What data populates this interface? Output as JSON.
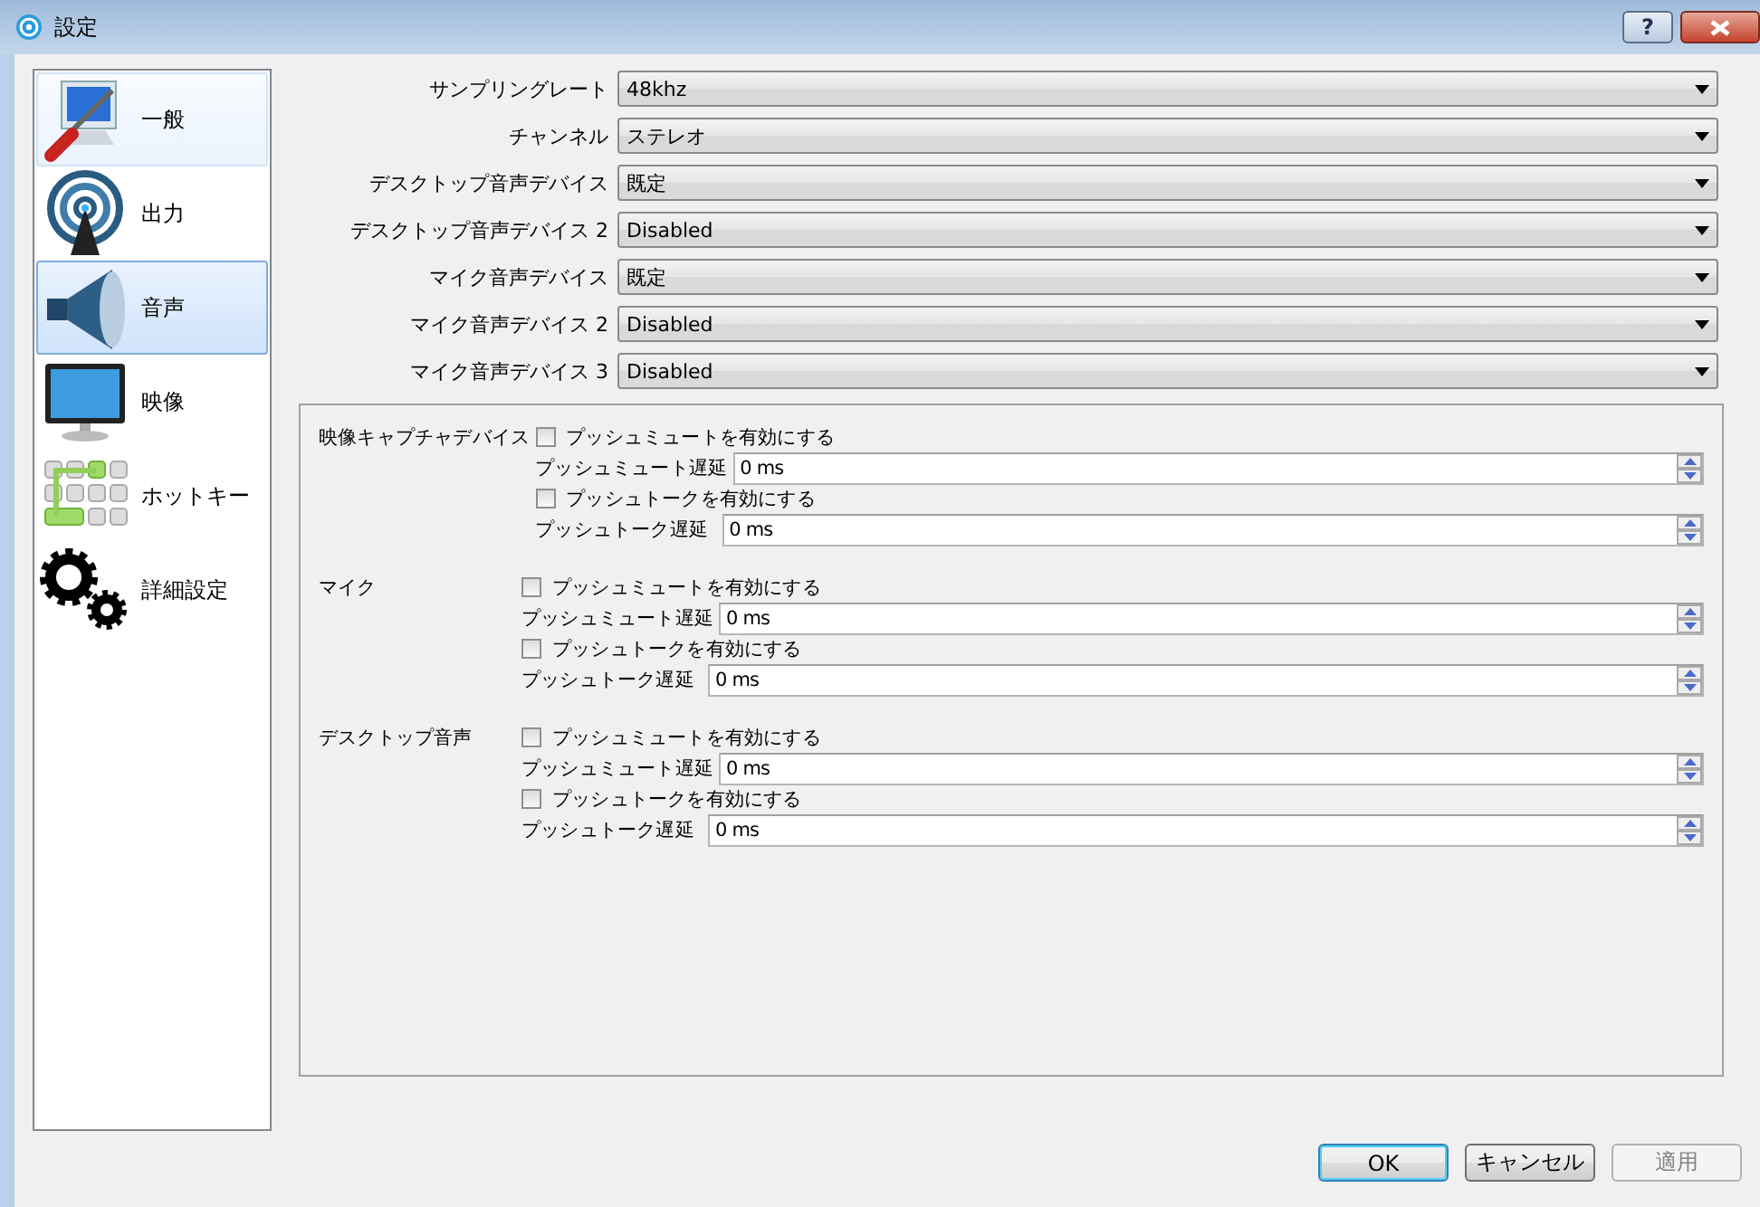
{
  "window": {
    "title": "設定",
    "help": "?"
  },
  "sidebar": {
    "items": [
      {
        "kind": "general",
        "label": "一般",
        "selected": false,
        "hover": true
      },
      {
        "kind": "output",
        "label": "出力",
        "selected": false,
        "hover": false
      },
      {
        "kind": "audio",
        "label": "音声",
        "selected": true,
        "hover": false
      },
      {
        "kind": "video",
        "label": "映像",
        "selected": false,
        "hover": false
      },
      {
        "kind": "hotkeys",
        "label": "ホットキー",
        "selected": false,
        "hover": false
      },
      {
        "kind": "advanced",
        "label": "詳細設定",
        "selected": false,
        "hover": false
      }
    ]
  },
  "settings": [
    {
      "label": "サンプリングレート",
      "value": "48khz"
    },
    {
      "label": "チャンネル",
      "value": "ステレオ"
    },
    {
      "label": "デスクトップ音声デバイス",
      "value": "既定"
    },
    {
      "label": "デスクトップ音声デバイス 2",
      "value": "Disabled"
    },
    {
      "label": "マイク音声デバイス",
      "value": "既定"
    },
    {
      "label": "マイク音声デバイス 2",
      "value": "Disabled"
    },
    {
      "label": "マイク音声デバイス 3",
      "value": "Disabled"
    }
  ],
  "hotkey_sections": [
    {
      "title": "映像キャプチャデバイス",
      "rows": [
        {
          "kind": "checkbox",
          "label": "プッシュミュートを有効にする",
          "checked": false
        },
        {
          "kind": "spin",
          "label": "プッシュミュート遅延",
          "value": "0 ms"
        },
        {
          "kind": "checkbox",
          "label": "プッシュトークを有効にする",
          "checked": false
        },
        {
          "kind": "spin",
          "label": "プッシュトーク遅延",
          "value": "0 ms"
        }
      ]
    },
    {
      "title": "マイク",
      "rows": [
        {
          "kind": "checkbox",
          "label": "プッシュミュートを有効にする",
          "checked": false
        },
        {
          "kind": "spin",
          "label": "プッシュミュート遅延",
          "value": "0 ms"
        },
        {
          "kind": "checkbox",
          "label": "プッシュトークを有効にする",
          "checked": false
        },
        {
          "kind": "spin",
          "label": "プッシュトーク遅延",
          "value": "0 ms"
        }
      ]
    },
    {
      "title": "デスクトップ音声",
      "rows": [
        {
          "kind": "checkbox",
          "label": "プッシュミュートを有効にする",
          "checked": false
        },
        {
          "kind": "spin",
          "label": "プッシュミュート遅延",
          "value": "0 ms"
        },
        {
          "kind": "checkbox",
          "label": "プッシュトークを有効にする",
          "checked": false
        },
        {
          "kind": "spin",
          "label": "プッシュトーク遅延",
          "value": "0 ms"
        }
      ]
    }
  ],
  "buttons": [
    {
      "label": "OK",
      "default": true,
      "disabled": false
    },
    {
      "label": "キャンセル",
      "default": false,
      "disabled": false
    },
    {
      "label": "適用",
      "default": false,
      "disabled": true
    }
  ]
}
